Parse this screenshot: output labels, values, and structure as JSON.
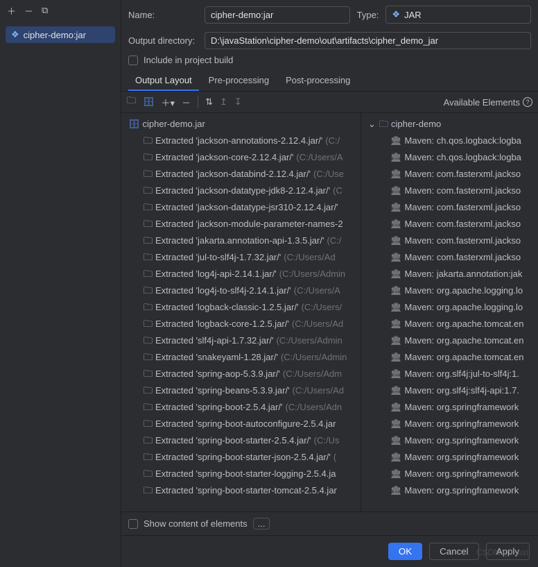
{
  "sidebar": {
    "artifact": "cipher-demo:jar"
  },
  "form": {
    "nameLabel": "Name:",
    "name": "cipher-demo:jar",
    "typeLabel": "Type:",
    "type": "JAR",
    "outDirLabel": "Output directory:",
    "outDir": "D:\\javaStation\\cipher-demo\\out\\artifacts\\cipher_demo_jar",
    "includeBuild": "Include in project build"
  },
  "tabs": {
    "layout": "Output Layout",
    "pre": "Pre-processing",
    "post": "Post-processing"
  },
  "toolbar": {
    "availLabel": "Available Elements"
  },
  "tree": {
    "root": "cipher-demo.jar",
    "items": [
      {
        "name": "Extracted 'jackson-annotations-2.12.4.jar/'",
        "hint": "(C:/"
      },
      {
        "name": "Extracted 'jackson-core-2.12.4.jar/'",
        "hint": "(C:/Users/A"
      },
      {
        "name": "Extracted 'jackson-databind-2.12.4.jar/'",
        "hint": "(C:/Use"
      },
      {
        "name": "Extracted 'jackson-datatype-jdk8-2.12.4.jar/'",
        "hint": "(C"
      },
      {
        "name": "Extracted 'jackson-datatype-jsr310-2.12.4.jar/'",
        "hint": ""
      },
      {
        "name": "Extracted 'jackson-module-parameter-names-2",
        "hint": ""
      },
      {
        "name": "Extracted 'jakarta.annotation-api-1.3.5.jar/'",
        "hint": "(C:/"
      },
      {
        "name": "Extracted 'jul-to-slf4j-1.7.32.jar/'",
        "hint": "(C:/Users/Ad"
      },
      {
        "name": "Extracted 'log4j-api-2.14.1.jar/'",
        "hint": "(C:/Users/Admin"
      },
      {
        "name": "Extracted 'log4j-to-slf4j-2.14.1.jar/'",
        "hint": "(C:/Users/A"
      },
      {
        "name": "Extracted 'logback-classic-1.2.5.jar/'",
        "hint": "(C:/Users/"
      },
      {
        "name": "Extracted 'logback-core-1.2.5.jar/'",
        "hint": "(C:/Users/Ad"
      },
      {
        "name": "Extracted 'slf4j-api-1.7.32.jar/'",
        "hint": "(C:/Users/Admin"
      },
      {
        "name": "Extracted 'snakeyaml-1.28.jar/'",
        "hint": "(C:/Users/Admin"
      },
      {
        "name": "Extracted 'spring-aop-5.3.9.jar/'",
        "hint": "(C:/Users/Adm"
      },
      {
        "name": "Extracted 'spring-beans-5.3.9.jar/'",
        "hint": "(C:/Users/Ad"
      },
      {
        "name": "Extracted 'spring-boot-2.5.4.jar/'",
        "hint": "(C:/Users/Adn"
      },
      {
        "name": "Extracted 'spring-boot-autoconfigure-2.5.4.jar",
        "hint": ""
      },
      {
        "name": "Extracted 'spring-boot-starter-2.5.4.jar/'",
        "hint": "(C:/Us"
      },
      {
        "name": "Extracted 'spring-boot-starter-json-2.5.4.jar/'",
        "hint": "("
      },
      {
        "name": "Extracted 'spring-boot-starter-logging-2.5.4.ja",
        "hint": ""
      },
      {
        "name": "Extracted 'spring-boot-starter-tomcat-2.5.4.jar",
        "hint": ""
      }
    ]
  },
  "avail": {
    "root": "cipher-demo",
    "items": [
      "Maven: ch.qos.logback:logba",
      "Maven: ch.qos.logback:logba",
      "Maven: com.fasterxml.jackso",
      "Maven: com.fasterxml.jackso",
      "Maven: com.fasterxml.jackso",
      "Maven: com.fasterxml.jackso",
      "Maven: com.fasterxml.jackso",
      "Maven: com.fasterxml.jackso",
      "Maven: jakarta.annotation:jak",
      "Maven: org.apache.logging.lo",
      "Maven: org.apache.logging.lo",
      "Maven: org.apache.tomcat.en",
      "Maven: org.apache.tomcat.en",
      "Maven: org.apache.tomcat.en",
      "Maven: org.slf4j:jul-to-slf4j:1.",
      "Maven: org.slf4j:slf4j-api:1.7.",
      "Maven: org.springframework",
      "Maven: org.springframework",
      "Maven: org.springframework",
      "Maven: org.springframework",
      "Maven: org.springframework",
      "Maven: org.springframework"
    ]
  },
  "footer": {
    "showContent": "Show content of elements",
    "dots": "..."
  },
  "buttons": {
    "ok": "OK",
    "cancel": "Cancel",
    "apply": "Apply"
  },
  "watermark": "CSDN @muxi"
}
